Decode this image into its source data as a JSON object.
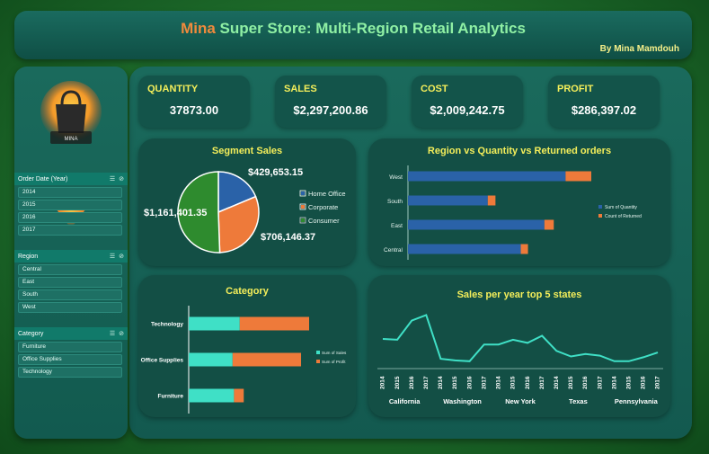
{
  "header": {
    "title_brand": "Mina",
    "title_rest": " Super Store: Multi-Region Retail Analytics",
    "byline": "By Mina Mamdouh"
  },
  "logo": {
    "text": "MINA"
  },
  "slicers": [
    {
      "title": "Order Date (Year)",
      "items": [
        "2014",
        "2015",
        "2016",
        "2017"
      ]
    },
    {
      "title": "Region",
      "items": [
        "Central",
        "East",
        "South",
        "West"
      ]
    },
    {
      "title": "Category",
      "items": [
        "Furniture",
        "Office Supplies",
        "Technology"
      ]
    }
  ],
  "kpis": [
    {
      "label": "QUANTITY",
      "value": "37873.00"
    },
    {
      "label": "SALES",
      "value": "$2,297,200.86"
    },
    {
      "label": "COST",
      "value": "$2,009,242.75"
    },
    {
      "label": "PROFIT",
      "value": "$286,397.02"
    }
  ],
  "colors": {
    "accent_yellow": "#f4ee5a",
    "brand_orange": "#f08a3c",
    "blue": "#2a62a8",
    "orange": "#ee7a3a",
    "green": "#2e8b2e",
    "turquoise": "#3fe0c6",
    "line": "#3fe0c6"
  },
  "chart_data": [
    {
      "type": "pie",
      "title": "Segment Sales",
      "labels": [
        "Home Office",
        "Corporate",
        "Consumer"
      ],
      "values": [
        429653.15,
        706146.37,
        1161401.35
      ],
      "value_labels": [
        "$429,653.15",
        "$706,146.37",
        "$1,161,401.35"
      ],
      "colors": [
        "#2a62a8",
        "#ee7a3a",
        "#2e8b2e"
      ],
      "legend": "right"
    },
    {
      "type": "bar",
      "orientation": "horizontal",
      "stacked": true,
      "title": "Region vs Quantity vs Returned orders",
      "categories": [
        "West",
        "South",
        "East",
        "Central"
      ],
      "series": [
        {
          "name": "Sum of Quantity",
          "values": [
            12266,
            6209,
            10618,
            8780
          ]
        },
        {
          "name": "Count of Returned",
          "values": [
            2000,
            600,
            730,
            560
          ]
        }
      ],
      "legend": "right"
    },
    {
      "type": "bar",
      "orientation": "horizontal",
      "stacked": true,
      "title": "Category",
      "categories": [
        "Technology",
        "Office Supplies",
        "Furniture"
      ],
      "series": [
        {
          "name": "Sum of Sales",
          "values": [
            836154,
            719047,
            742000
          ]
        },
        {
          "name": "Sum of Profit",
          "values": [
            1137000,
            1122000,
            160000
          ]
        }
      ],
      "legend": "right"
    },
    {
      "type": "line",
      "title": "Sales per year top 5 states",
      "x_groups": [
        "California",
        "Washington",
        "New York",
        "Texas",
        "Pennsylvania"
      ],
      "x": [
        "2014",
        "2015",
        "2016",
        "2017",
        "2014",
        "2015",
        "2016",
        "2017",
        "2014",
        "2015",
        "2016",
        "2017",
        "2014",
        "2015",
        "2016",
        "2017",
        "2014",
        "2015",
        "2016",
        "2017"
      ],
      "values": [
        95,
        94,
        118,
        125,
        70,
        68,
        67,
        88,
        88,
        94,
        90,
        99,
        80,
        73,
        76,
        74,
        67,
        67,
        72,
        78
      ],
      "ylim": [
        60,
        130
      ]
    }
  ]
}
